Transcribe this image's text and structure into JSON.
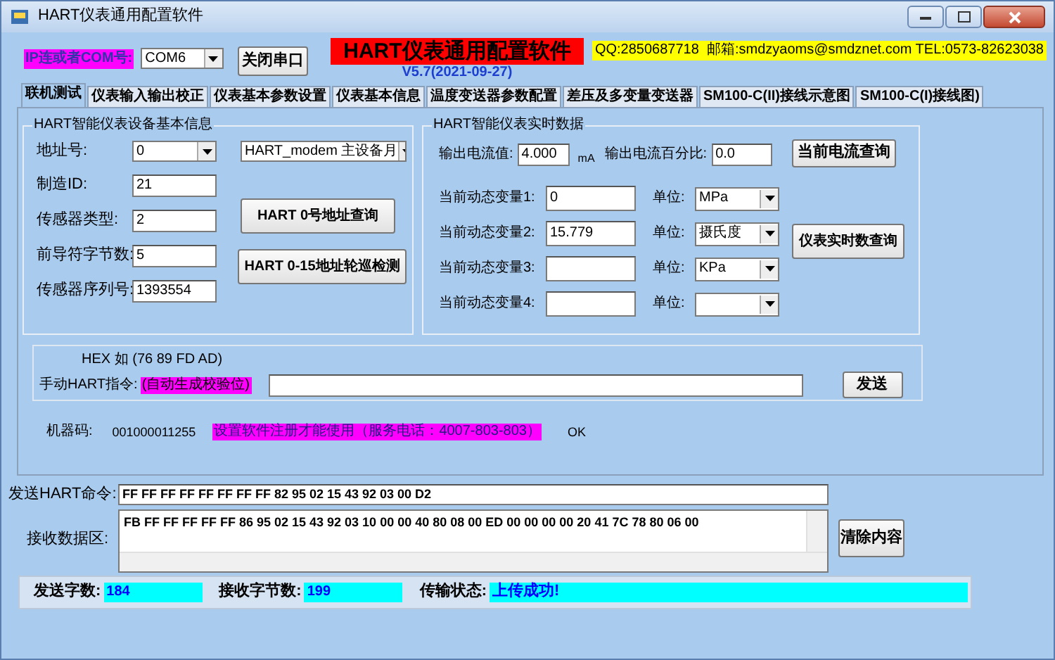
{
  "window": {
    "title": "HART仪表通用配置软件"
  },
  "connection": {
    "label": "IP连或者COM号:",
    "port": "COM6",
    "close_button": "关闭串口"
  },
  "app_title": "HART仪表通用配置软件",
  "version": "V5.7(2021-09-27)",
  "contact": "QQ:2850687718  邮箱:smdzyaoms@smdznet.com TEL:0573-82623038",
  "tabs": [
    {
      "label": "联机测试",
      "selected": true
    },
    {
      "label": "仪表输入输出校正",
      "selected": false
    },
    {
      "label": "仪表基本参数设置",
      "selected": false
    },
    {
      "label": "仪表基本信息",
      "selected": false
    },
    {
      "label": "温度变送器参数配置",
      "selected": false
    },
    {
      "label": "差压及多变量变送器",
      "selected": false
    },
    {
      "label": "SM100-C(II)接线示意图",
      "selected": false
    },
    {
      "label": "SM100-C(I)接线图)",
      "selected": false
    }
  ],
  "device_info": {
    "title": "HART智能仪表设备基本信息",
    "fields": [
      {
        "label": "地址号:",
        "value": "0",
        "kind": "select"
      },
      {
        "label": "制造ID:",
        "value": "21",
        "kind": "input"
      },
      {
        "label": "传感器类型:",
        "value": "2",
        "kind": "input"
      },
      {
        "label": "前导符字节数:",
        "value": "5",
        "kind": "input"
      },
      {
        "label": "传感器序列号:",
        "value": "1393554",
        "kind": "input"
      }
    ],
    "modem": "HART_modem 主设备月",
    "buttons": [
      "HART 0号地址查询",
      "HART 0-15地址轮巡检测"
    ]
  },
  "realtime": {
    "title": "HART智能仪表实时数据",
    "current_label": "输出电流值:",
    "current": "4.000",
    "current_unit": "mA",
    "percent_label": "输出电流百分比:",
    "percent": "0.0",
    "current_button": "当前电流查询",
    "variables": [
      {
        "label": "当前动态变量1:",
        "value": "0",
        "unit_label": "单位:",
        "unit": "MPa"
      },
      {
        "label": "当前动态变量2:",
        "value": "15.779",
        "unit_label": "单位:",
        "unit": "摄氏度"
      },
      {
        "label": "当前动态变量3:",
        "unit_label": "单位:",
        "unit": "KPa"
      },
      {
        "label": "当前动态变量4:",
        "unit_label": "单位:"
      }
    ],
    "query_button": "仪表实时数查询"
  },
  "manual": {
    "hint": "HEX 如 (76 89 FD AD)",
    "label": "手动HART指令:",
    "note": "(自动生成校验位)",
    "send_button": "发送"
  },
  "machine": {
    "label": "机器码:",
    "code": "001000011255",
    "notice": "设置软件注册才能使用（服务电话：4007-803-803）",
    "status": "OK"
  },
  "send": {
    "label": "发送HART命令:",
    "value": "FF FF FF FF FF FF FF FF 82 95 02 15 43 92 03 00 D2"
  },
  "receive": {
    "label": "接收数据区:",
    "value": "FB FF FF FF FF FF 86 95 02 15 43 92 03 10 00 00 40 80 08 00 ED 00 00 00 00 20 41 7C 78 80 06 00",
    "clear_button": "清除内容"
  },
  "stats": [
    {
      "label": "发送字数:",
      "value": "184"
    },
    {
      "label": "接收字节数:",
      "value": "199"
    },
    {
      "label": "传输状态:",
      "value": "上传成功!"
    }
  ]
}
